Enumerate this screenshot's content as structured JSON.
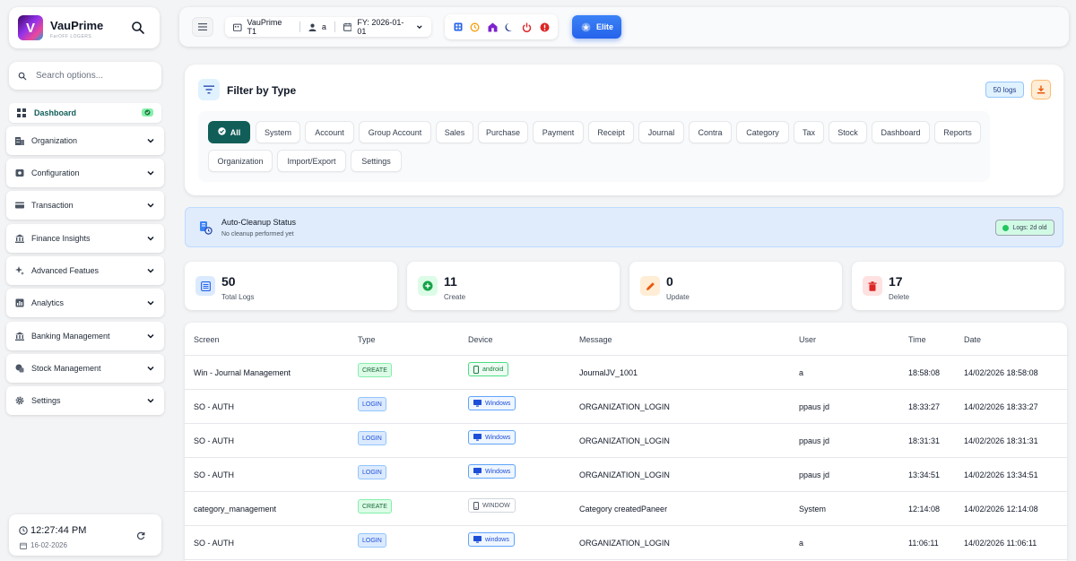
{
  "sidebar": {
    "brand_name": "VauPrime",
    "brand_sub": "FarOFF LOGERS",
    "search_placeholder": "Search options...",
    "dashboard_label": "Dashboard",
    "items": [
      {
        "label": "Organization",
        "icon": "organization-icon"
      },
      {
        "label": "Configuration",
        "icon": "configuration-icon"
      },
      {
        "label": "Transaction",
        "icon": "transaction-icon"
      },
      {
        "label": "Finance Insights",
        "icon": "bank-icon"
      },
      {
        "label": "Advanced Featues",
        "icon": "sparkle-icon"
      },
      {
        "label": "Analytics",
        "icon": "analytics-icon"
      },
      {
        "label": "Banking Management",
        "icon": "bank-icon"
      },
      {
        "label": "Stock Management",
        "icon": "stock-icon"
      },
      {
        "label": "Settings",
        "icon": "gear-icon"
      }
    ],
    "clock": {
      "time": "12:27:44 PM",
      "date": "16-02-2026"
    }
  },
  "topbar": {
    "company": "VauPrime T1",
    "user": "a",
    "fy": "FY: 2026-01-01",
    "elite_label": "Elite"
  },
  "filter": {
    "title": "Filter by Type",
    "logs_badge": "50 logs",
    "chips": [
      "All",
      "System",
      "Account",
      "Group Account",
      "Sales",
      "Purchase",
      "Payment",
      "Receipt",
      "Journal",
      "Contra",
      "Category",
      "Tax",
      "Stock",
      "Dashboard",
      "Reports",
      "Organization",
      "Import/Export",
      "Settings"
    ],
    "active": "All"
  },
  "cleanup": {
    "title": "Auto-Cleanup Status",
    "subtitle": "No cleanup performed yet",
    "badge": "Logs: 2d old"
  },
  "stats": [
    {
      "value": "50",
      "label": "Total Logs",
      "color": "#2563eb"
    },
    {
      "value": "11",
      "label": "Create",
      "color": "#16a34a"
    },
    {
      "value": "0",
      "label": "Update",
      "color": "#ea580c"
    },
    {
      "value": "17",
      "label": "Delete",
      "color": "#dc2626"
    }
  ],
  "table": {
    "headers": [
      "Screen",
      "Type",
      "Device",
      "Message",
      "User",
      "Time",
      "Date"
    ],
    "rows": [
      {
        "screen": "Win - Journal Management",
        "type": "CREATE",
        "device": "android",
        "message": "JournalJV_1001",
        "user": "a",
        "time": "18:58:08",
        "date": "14/02/2026 18:58:08"
      },
      {
        "screen": "SO - AUTH",
        "type": "LOGIN",
        "device": "Windows",
        "message": "ORGANIZATION_LOGIN",
        "user": "ppaus jd",
        "time": "18:33:27",
        "date": "14/02/2026 18:33:27"
      },
      {
        "screen": "SO - AUTH",
        "type": "LOGIN",
        "device": "Windows",
        "message": "ORGANIZATION_LOGIN",
        "user": "ppaus jd",
        "time": "18:31:31",
        "date": "14/02/2026 18:31:31"
      },
      {
        "screen": "SO - AUTH",
        "type": "LOGIN",
        "device": "Windows",
        "message": "ORGANIZATION_LOGIN",
        "user": "ppaus jd",
        "time": "13:34:51",
        "date": "14/02/2026 13:34:51"
      },
      {
        "screen": "category_management",
        "type": "CREATE",
        "device": "WINDOW",
        "message": "Category createdPaneer",
        "user": "System",
        "time": "12:14:08",
        "date": "14/02/2026 12:14:08"
      },
      {
        "screen": "SO - AUTH",
        "type": "LOGIN",
        "device": "windows",
        "message": "ORGANIZATION_LOGIN",
        "user": "a",
        "time": "11:06:11",
        "date": "14/02/2026 11:06:11"
      }
    ]
  }
}
